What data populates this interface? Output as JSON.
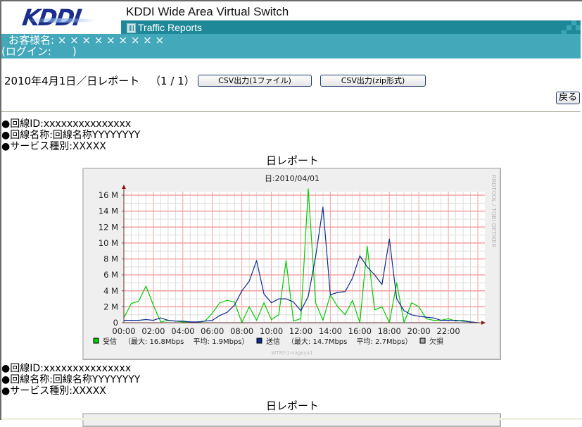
{
  "header": {
    "logo_text": "KDDI",
    "app_title": "KDDI Wide Area Virtual Switch",
    "section_label": "Traffic Reports",
    "section_icon": "report-icon",
    "customer_label": "お客様名: × × × × × × × × ×",
    "login_label": "(ログイン:　　)"
  },
  "report_bar": {
    "title": "2010年4月1日／日レポート",
    "page_indicator": "（1 / 1）",
    "csv_single_button": "CSV出力(1ファイル)",
    "csv_zip_button": "CSV出力(zip形式)",
    "back_button": "戻る"
  },
  "circuits": [
    {
      "circuit_id": "●回線ID:xxxxxxxxxxxxxxx",
      "circuit_name": "●回線名称:回線名称YYYYYYYY",
      "service_type": "●サービス種別:XXXXX",
      "report_title": "日レポート"
    },
    {
      "circuit_id": "●回線ID:xxxxxxxxxxxxxxx",
      "circuit_name": "●回線名称:回線名称YYYYYYYY",
      "service_type": "●サービス種別:XXXXX",
      "report_title": "日レポート"
    }
  ],
  "chart_data": {
    "type": "line",
    "title": "日:2010/04/01",
    "xlabel": "",
    "ylabel": "",
    "side_label": "RRDTOOL / TOBI OETIKER",
    "footer": "WTRY-1-nagoya1",
    "ylim": [
      0,
      17
    ],
    "yticks": [
      0,
      2,
      4,
      6,
      8,
      10,
      12,
      14,
      16
    ],
    "ytick_labels": [
      "0",
      "2 M",
      "4 M",
      "6 M",
      "8 M",
      "10 M",
      "12 M",
      "14 M",
      "16 M"
    ],
    "xlim_hours": [
      0,
      24
    ],
    "xticks_hours": [
      0,
      2,
      4,
      6,
      8,
      10,
      12,
      14,
      16,
      18,
      20,
      22
    ],
    "xtick_labels": [
      "00:00",
      "02:00",
      "04:00",
      "06:00",
      "08:00",
      "10:00",
      "12:00",
      "14:00",
      "16:00",
      "18:00",
      "20:00",
      "22:00"
    ],
    "grid": true,
    "legend_position": "bottom",
    "x_hours": [
      0,
      0.5,
      1,
      1.5,
      2,
      2.5,
      3,
      3.5,
      4,
      4.5,
      5,
      5.5,
      6,
      6.5,
      7,
      7.5,
      8,
      8.5,
      9,
      9.5,
      10,
      10.5,
      11,
      11.5,
      12,
      12.5,
      13,
      13.5,
      14,
      14.5,
      15,
      15.5,
      16,
      16.5,
      17,
      17.5,
      18,
      18.5,
      19,
      19.5,
      20,
      20.5,
      21,
      21.5,
      22,
      22.5,
      23,
      23.5,
      24
    ],
    "series": [
      {
        "name": "受信",
        "color": "#00cc00",
        "stats": "（最大: 16.8Mbps　 平均:  1.9Mbps）",
        "values": [
          0.6,
          2.4,
          2.7,
          4.6,
          2.2,
          0.1,
          0.3,
          0.2,
          0.1,
          0.1,
          0.0,
          0.2,
          1.2,
          2.5,
          2.8,
          2.6,
          0.0,
          2.0,
          0.3,
          2.5,
          0.4,
          1.0,
          7.8,
          0.2,
          0.5,
          16.8,
          2.5,
          0.3,
          3.5,
          2.0,
          1.0,
          2.8,
          0.0,
          9.6,
          1.6,
          2.0,
          0.0,
          5.0,
          0.0,
          2.5,
          2.0,
          0.5,
          0.3,
          0.3,
          0.5,
          0.2,
          0.3,
          0.1,
          0.0
        ]
      },
      {
        "name": "送信",
        "color": "#0d2c92",
        "stats": "（最大: 14.7Mbps　 平均:  2.7Mbps）",
        "values": [
          0.3,
          0.3,
          0.3,
          0.4,
          0.3,
          0.6,
          0.3,
          0.2,
          0.2,
          0.1,
          0.1,
          0.2,
          0.3,
          0.9,
          1.3,
          2.2,
          4.0,
          5.2,
          7.8,
          3.6,
          2.5,
          3.0,
          3.0,
          2.6,
          1.5,
          3.3,
          8.3,
          14.5,
          3.5,
          3.8,
          3.9,
          5.6,
          8.4,
          7.0,
          6.0,
          4.8,
          10.5,
          3.0,
          1.5,
          1.0,
          0.8,
          0.7,
          0.6,
          0.3,
          0.3,
          0.3,
          0.2,
          0.1,
          0.0
        ]
      }
    ],
    "missing_legend": "欠損"
  }
}
